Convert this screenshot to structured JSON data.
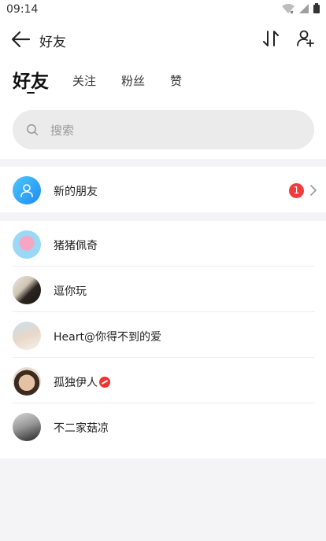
{
  "status_bar": {
    "time": "09:14"
  },
  "header": {
    "title": "好友"
  },
  "tabs": [
    {
      "label": "好友",
      "active": true
    },
    {
      "label": "关注",
      "active": false
    },
    {
      "label": "粉丝",
      "active": false
    },
    {
      "label": "赞",
      "active": false
    }
  ],
  "search": {
    "placeholder": "搜索"
  },
  "new_friends": {
    "label": "新的朋友",
    "badge": "1"
  },
  "friends": [
    {
      "name": "猪猪佩奇"
    },
    {
      "name": "逗你玩"
    },
    {
      "name": "Heart@你得不到的爱"
    },
    {
      "name": "孤独伊人"
    },
    {
      "name": "不二家菇凉"
    }
  ],
  "colors": {
    "badge": "#f03c3c",
    "new_friends_avatar": "#2fa8f8",
    "search_bg": "#ebebeb"
  }
}
